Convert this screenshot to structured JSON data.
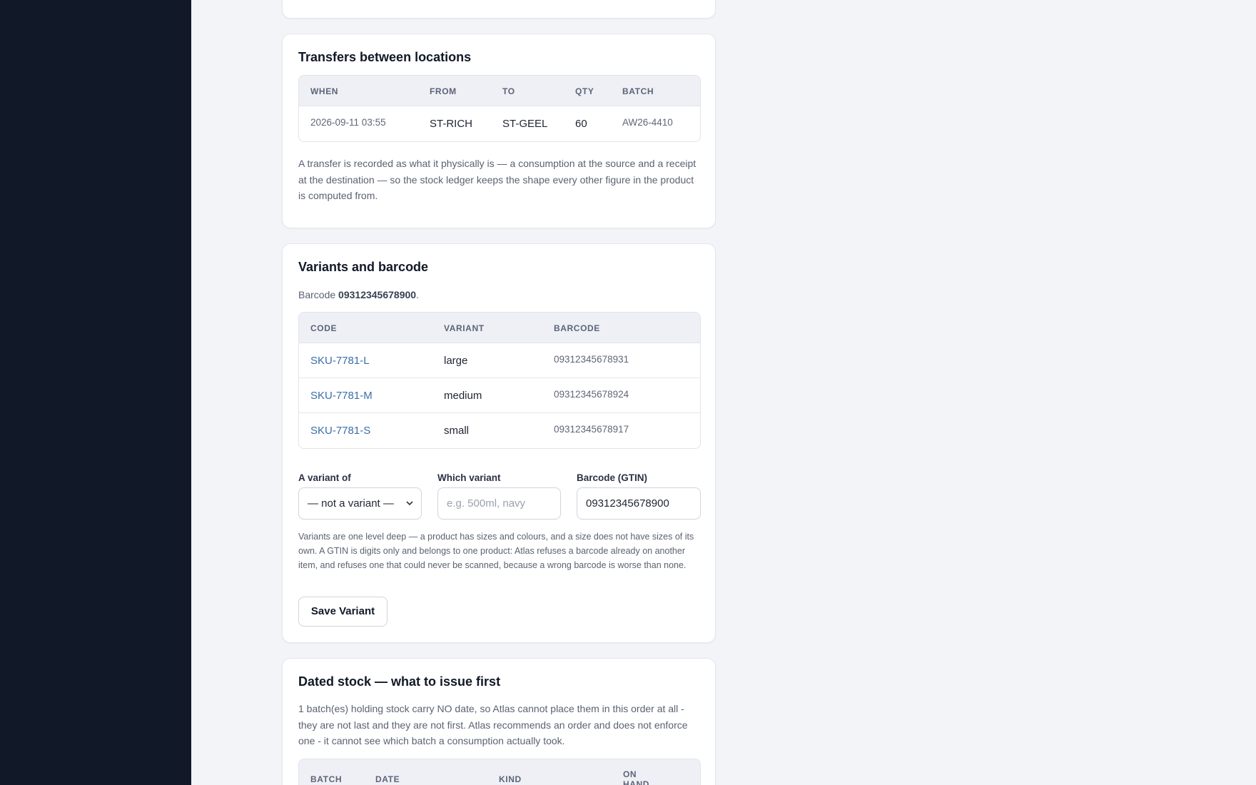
{
  "transfers": {
    "title": "Transfers between locations",
    "columns": [
      "WHEN",
      "FROM",
      "TO",
      "QTY",
      "BATCH"
    ],
    "rows": [
      {
        "when": "2026-09-11 03:55",
        "from": "ST-RICH",
        "to": "ST-GEEL",
        "qty": "60",
        "batch": "AW26-4410"
      }
    ],
    "note": "A transfer is recorded as what it physically is — a consumption at the source and a receipt at the destination — so the stock ledger keeps the shape every other figure in the product is computed from."
  },
  "variants": {
    "title": "Variants and barcode",
    "barcode_prefix": "Barcode",
    "barcode_value": "09312345678900",
    "barcode_suffix": ".",
    "columns": [
      "CODE",
      "VARIANT",
      "BARCODE"
    ],
    "rows": [
      {
        "code": "SKU-7781-L",
        "variant": "large",
        "barcode": "09312345678931"
      },
      {
        "code": "SKU-7781-M",
        "variant": "medium",
        "barcode": "09312345678924"
      },
      {
        "code": "SKU-7781-S",
        "variant": "small",
        "barcode": "09312345678917"
      }
    ],
    "form": {
      "variant_of_label": "A variant of",
      "variant_of_value": "— not a variant —",
      "which_variant_label": "Which variant",
      "which_variant_placeholder": "e.g. 500ml, navy",
      "gtin_label": "Barcode (GTIN)",
      "gtin_value": "09312345678900"
    },
    "help": "Variants are one level deep — a product has sizes and colours, and a size does not have sizes of its own. A GTIN is digits only and belongs to one product: Atlas refuses a barcode already on another item, and refuses one that could never be scanned, because a wrong barcode is worse than none.",
    "save_label": "Save Variant"
  },
  "dated": {
    "title": "Dated stock — what to issue first",
    "note": "1 batch(es) holding stock carry NO date, so Atlas cannot place them in this order at all - they are not last and they are not first. Atlas recommends an order and does not enforce one - it cannot see which batch a consumption actually took.",
    "columns": [
      "BATCH",
      "DATE",
      "KIND",
      "ON HAND"
    ]
  },
  "colors": {
    "sidebar": "#111827",
    "background": "#f3f4f8",
    "link": "#3b6ea8"
  }
}
